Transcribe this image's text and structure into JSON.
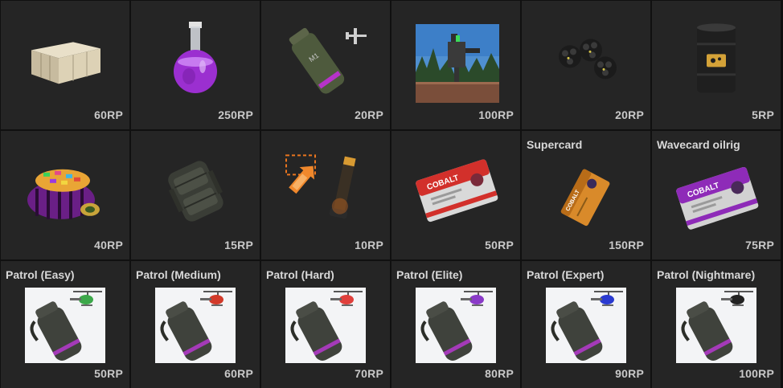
{
  "items": [
    {
      "icon": "crate-icon",
      "price": "60RP"
    },
    {
      "icon": "purple-flask-icon",
      "price": "250RP"
    },
    {
      "icon": "smoke-grenade-plane-icon",
      "price": "20RP"
    },
    {
      "icon": "turret-photo-icon",
      "price": "100RP"
    },
    {
      "icon": "berry-clusters-icon",
      "price": "20RP"
    },
    {
      "icon": "oil-barrel-icon",
      "price": "5RP"
    },
    {
      "icon": "candy-bag-icon",
      "price": "40RP"
    },
    {
      "icon": "backpack-icon",
      "price": "15RP"
    },
    {
      "icon": "marker-flare-icon",
      "price": "10RP"
    },
    {
      "icon": "red-keycard-icon",
      "price": "50RP"
    },
    {
      "name": "Supercard",
      "icon": "orange-keycard-icon",
      "price": "150RP"
    },
    {
      "name": "Wavecard oilrig",
      "icon": "purple-keycard-icon",
      "price": "75RP"
    },
    {
      "name": "Patrol (Easy)",
      "icon": "patrol-easy-icon",
      "accent": "#3ca84a",
      "price": "50RP"
    },
    {
      "name": "Patrol (Medium)",
      "icon": "patrol-medium-icon",
      "accent": "#d23a2a",
      "price": "60RP"
    },
    {
      "name": "Patrol (Hard)",
      "icon": "patrol-hard-icon",
      "accent": "#e0403c",
      "price": "70RP"
    },
    {
      "name": "Patrol (Elite)",
      "icon": "patrol-elite-icon",
      "accent": "#8a3ac8",
      "price": "80RP"
    },
    {
      "name": "Patrol (Expert)",
      "icon": "patrol-expert-icon",
      "accent": "#2a3ad0",
      "price": "90RP"
    },
    {
      "name": "Patrol (Nightmare)",
      "icon": "patrol-nightmare-icon",
      "accent": "#222222",
      "price": "100RP"
    }
  ]
}
